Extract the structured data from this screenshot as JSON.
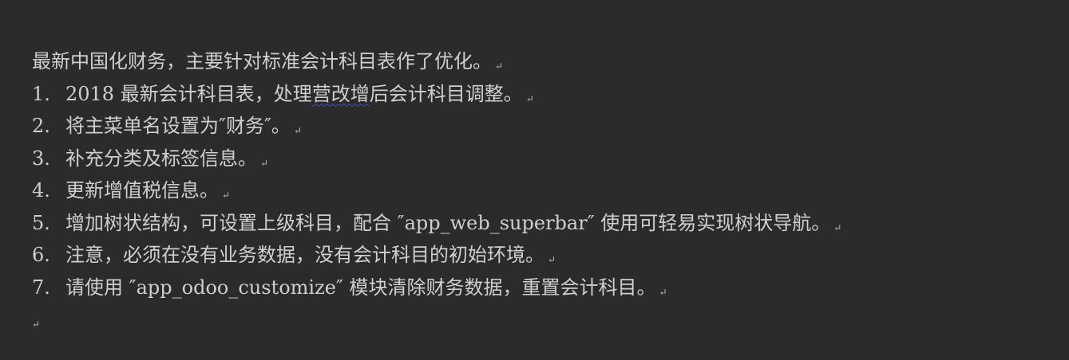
{
  "intro": "最新中国化财务，主要针对标准会计科目表作了优化。",
  "items": [
    {
      "num": "1.",
      "before": "2018 最新会计科目表，处理",
      "marked": "营改增",
      "after": "后会计科目调整。"
    },
    {
      "num": "2.",
      "text": "将主菜单名设置为″财务″。"
    },
    {
      "num": "3.",
      "text": "补充分类及标签信息。"
    },
    {
      "num": "4.",
      "text": "更新增值税信息。"
    },
    {
      "num": "5.",
      "text": "增加树状结构，可设置上级科目，配合 ″app_web_superbar″ 使用可轻易实现树状导航。"
    },
    {
      "num": "6.",
      "text": "注意，必须在没有业务数据，没有会计科目的初始环境。"
    },
    {
      "num": "7.",
      "text": "请使用 ″app_odoo_customize″ 模块清除财务数据，重置会计科目。"
    }
  ],
  "paragraph_mark": "↵"
}
